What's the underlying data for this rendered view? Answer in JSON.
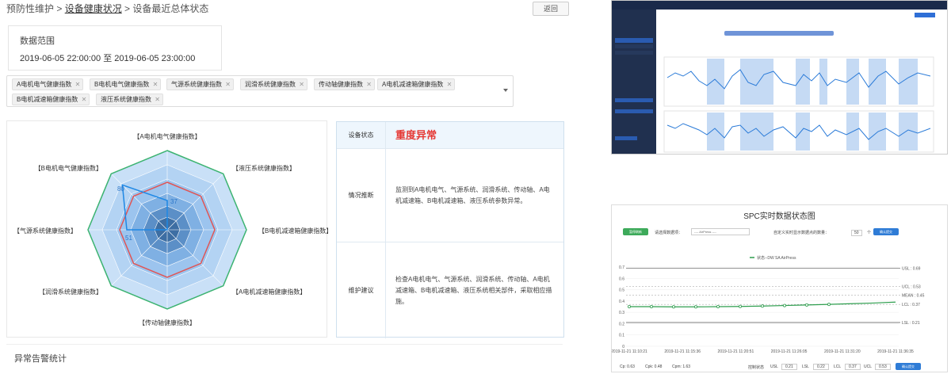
{
  "breadcrumb": {
    "part1": "预防性维护",
    "sep": " > ",
    "part2": "设备健康状况",
    "part3": "设备最近总体状态"
  },
  "back_label": "返回",
  "range": {
    "title": "数据范围",
    "value": "2019-06-05 22:00:00 至 2019-06-05 23:00:00"
  },
  "tags": [
    "A电机电气健康指数",
    "B电机电气健康指数",
    "气源系统健康指数",
    "润滑系统健康指数",
    "传动轴健康指数",
    "A电机减速箱健康指数",
    "B电机减速箱健康指数",
    "液压系统健康指数"
  ],
  "radar": {
    "axes": [
      "【A电机电气健康指数】",
      "【液压系统健康指数】",
      "【B电机减速箱健康指数】",
      "【A电机减速箱健康指数】",
      "【传动轴健康指数】",
      "【润滑系统健康指数】",
      "【气源系统健康指数】",
      "【B电机电气健康指数】"
    ],
    "values": [
      37,
      0,
      0,
      0,
      0,
      0,
      51,
      80
    ],
    "value_labels": [
      "37",
      "51",
      "80"
    ],
    "max": 100,
    "colors": {
      "outer": "#3cb371",
      "warn": "#e05555",
      "series": "#1e88e5"
    }
  },
  "status": {
    "row1_key": "设备状态",
    "row1_val": "重度异常",
    "row2_key": "情况推断",
    "row2_val": "监测到A电机电气、气源系统、润滑系统、传动轴、A电机减速箱、B电机减速箱、液压系统参数异常。",
    "row3_key": "维护建议",
    "row3_val": "检查A电机电气、气源系统、润滑系统、传动轴、A电机减速箱、B电机减速箱、液压系统相关部件，采取相应措施。"
  },
  "alarm_title": "异常告警统计",
  "spc": {
    "title": "SPC实时数据状态图",
    "legend": "状态--DW SA AirPress",
    "green_btn": "暂停刷新",
    "show_label": "请选择数据项：",
    "select_value": "---- AirPress ----",
    "count_label": "自定义实时显示数据点的数量：",
    "count_value": "50",
    "count_unit": "个",
    "confirm_btn": "确认提交",
    "usl": "USL : 0.69",
    "ucl": "UCL : 0.53",
    "mean": "MEAN : 0.45",
    "lcl": "LCL : 0.37",
    "lsl": "LSL : 0.21",
    "y_ticks": [
      "0.7",
      "0.6",
      "0.5",
      "0.4",
      "0.3",
      "0.2",
      "0.1",
      "0"
    ],
    "x_ticks": [
      "2019-11-21 11:10:21",
      "2019-11-21 11:15:36",
      "2019-11-21 11:20:51",
      "2019-11-21 11:26:05",
      "2019-11-21 11:31:20",
      "2019-11-21 11:36:35"
    ],
    "stats": {
      "cp": "Cp: 0.63",
      "cpk": "Cpk: 0.48",
      "cpm": "Cpm: 1.63",
      "bottom_label": "控制状态",
      "usl_k": "USL",
      "usl_v": "0.21",
      "lsl_k": "LSL",
      "lsl_v": "0.22",
      "lcl_k": "LCL",
      "lcl_v": "0.37",
      "ucl_k": "UCL",
      "ucl_v": "0.53",
      "submit": "确认提交"
    }
  },
  "chart_data": {
    "type": "line",
    "title": "SPC实时数据状态图",
    "series": [
      {
        "name": "状态--DW SA AirPress",
        "values": [
          0.35,
          0.35,
          0.348,
          0.348,
          0.35,
          0.352,
          0.355,
          0.36,
          0.365,
          0.37,
          0.376,
          0.382,
          0.39
        ]
      }
    ],
    "ylim": [
      0,
      0.7
    ]
  }
}
